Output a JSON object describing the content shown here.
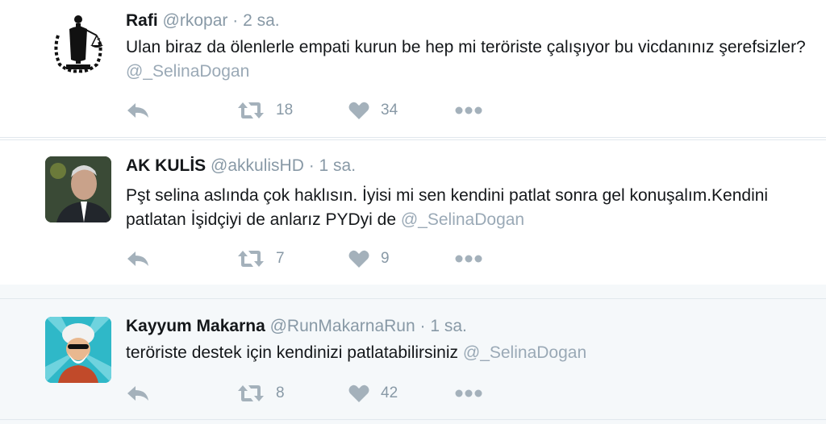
{
  "tweets": [
    {
      "name": "Rafi",
      "handle": "@rkopar",
      "sep": "·",
      "time": "2 sa.",
      "text": "Ulan biraz da ölenlerle empati kurun be hep mi teröriste çalışıyor bu vicdanınız şerefsizler?",
      "mention": "@_SelinaDogan",
      "retweets": "18",
      "likes": "34",
      "avatar_icon": "justice-scales-icon"
    },
    {
      "name": "AK KULİS",
      "handle": "@akkulisHD",
      "sep": "·",
      "time": "1 sa.",
      "text": "Pşt selina aslında çok haklısın. İyisi mi sen kendini patlat sonra gel konuşalım.Kendini patlatan İşidçiyi de anlarız PYDyi de",
      "mention": "@_SelinaDogan",
      "retweets": "7",
      "likes": "9",
      "avatar_icon": "portrait-photo"
    },
    {
      "name": "Kayyum Makarna",
      "handle": "@RunMakarnaRun",
      "sep": "·",
      "time": "1 sa.",
      "text": "teröriste destek için kendinizi patlatabilirsiniz",
      "mention": "@_SelinaDogan",
      "retweets": "8",
      "likes": "42",
      "avatar_icon": "cartoon-character-avatar"
    }
  ],
  "colors": {
    "muted": "#8899a6",
    "icon": "#a4b1bb",
    "divider": "#e1e8ed",
    "highlight_bg": "#f5f8fa"
  }
}
